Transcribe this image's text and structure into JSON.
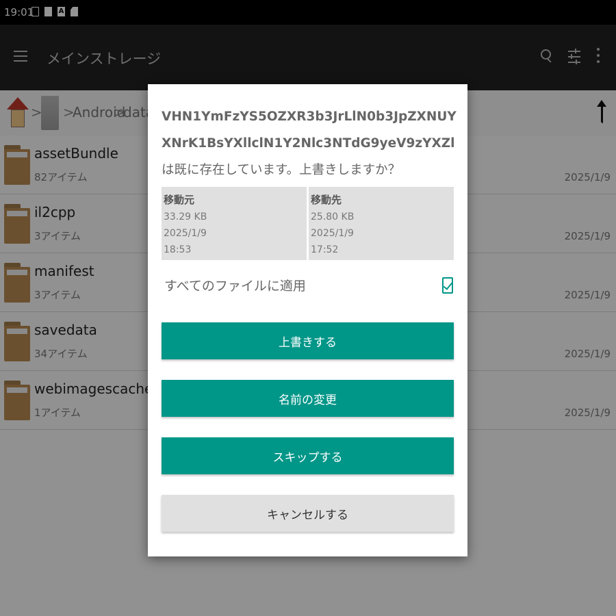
{
  "status_bar": {
    "time": "19:01",
    "icons": [
      "folder-icon",
      "image-icon",
      "a-letter-icon",
      "sd-card-icon"
    ]
  },
  "toolbar": {
    "title": "メインストレージ",
    "icons": [
      "menu-icon",
      "search-icon",
      "filter-icon",
      "more-vert-icon"
    ]
  },
  "breadcrumb": {
    "items": [
      "Android",
      "data"
    ],
    "separator": ">"
  },
  "files": [
    {
      "name": "assetBundle",
      "count": "82アイテム",
      "date": "2025/1/9"
    },
    {
      "name": "il2cpp",
      "count": "3アイテム",
      "date": "2025/1/9"
    },
    {
      "name": "manifest",
      "count": "3アイテム",
      "date": "2025/1/9"
    },
    {
      "name": "savedata",
      "count": "34アイテム",
      "date": "2025/1/9"
    },
    {
      "name": "webimagescache",
      "count": "1アイテム",
      "date": "2025/1/9"
    }
  ],
  "dialog": {
    "filename": "VHN1YmFzYS5OZXR3b3JrLlN0b3JpZXNUYXNrK1BsYXllclN1Y2Nlc3NTdG9yeV9zYXZl",
    "message_suffix": "は既に存在しています。上書きしますか？",
    "source": {
      "label": "移動元",
      "size": "33.29 KB",
      "date": "2025/1/9",
      "time": "18:53"
    },
    "destination": {
      "label": "移動先",
      "size": "25.80 KB",
      "date": "2025/1/9",
      "time": "17:52"
    },
    "apply_all_label": "すべてのファイルに適用",
    "apply_all_checked": true,
    "buttons": {
      "overwrite": "上書きする",
      "rename": "名前の変更",
      "skip": "スキップする",
      "cancel": "キャンセルする"
    }
  },
  "colors": {
    "accent": "#009688",
    "toolbar": "#212121"
  }
}
